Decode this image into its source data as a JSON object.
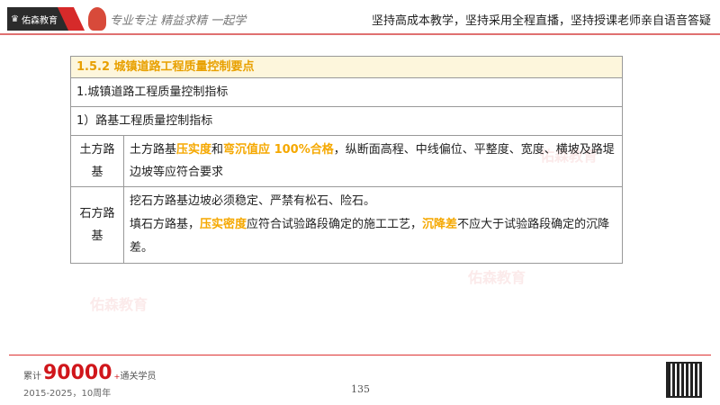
{
  "header": {
    "logo_text": "佑森教育",
    "script_slogan": "专业专注 精益求精 一起学",
    "tagline": "坚持高成本教学，坚持采用全程直播，坚持授课老师亲自语音答疑"
  },
  "table": {
    "title": "1.5.2 城镇道路工程质量控制要点",
    "row1": "1.城镇道路工程质量控制指标",
    "row2": "1）路基工程质量控制指标",
    "earth": {
      "label": "土方路基",
      "t1": "土方路基",
      "h1": "压实度",
      "t2": "和",
      "h2": "弯沉值应 100%合格",
      "t3": "，纵断面高程、中线偏位、平整度、宽度、横坡及路堤边坡等应符合要求"
    },
    "stone": {
      "label": "石方路基",
      "line1": "挖石方路基边坡必须稳定、严禁有松石、险石。",
      "t1": "填石方路基，",
      "h1": "压实密度",
      "t2": "应符合试验路段确定的施工工艺，",
      "h2": "沉降差",
      "t3": "不应大于试验路段确定的沉降差。"
    }
  },
  "footer": {
    "prefix": "累计",
    "count": "90000",
    "plus": "+",
    "suffix": "通关学员",
    "years": "2015-2025，10周年",
    "page": "135"
  },
  "colors": {
    "highlight": "#f5a800",
    "brand_red": "#d0161b"
  }
}
